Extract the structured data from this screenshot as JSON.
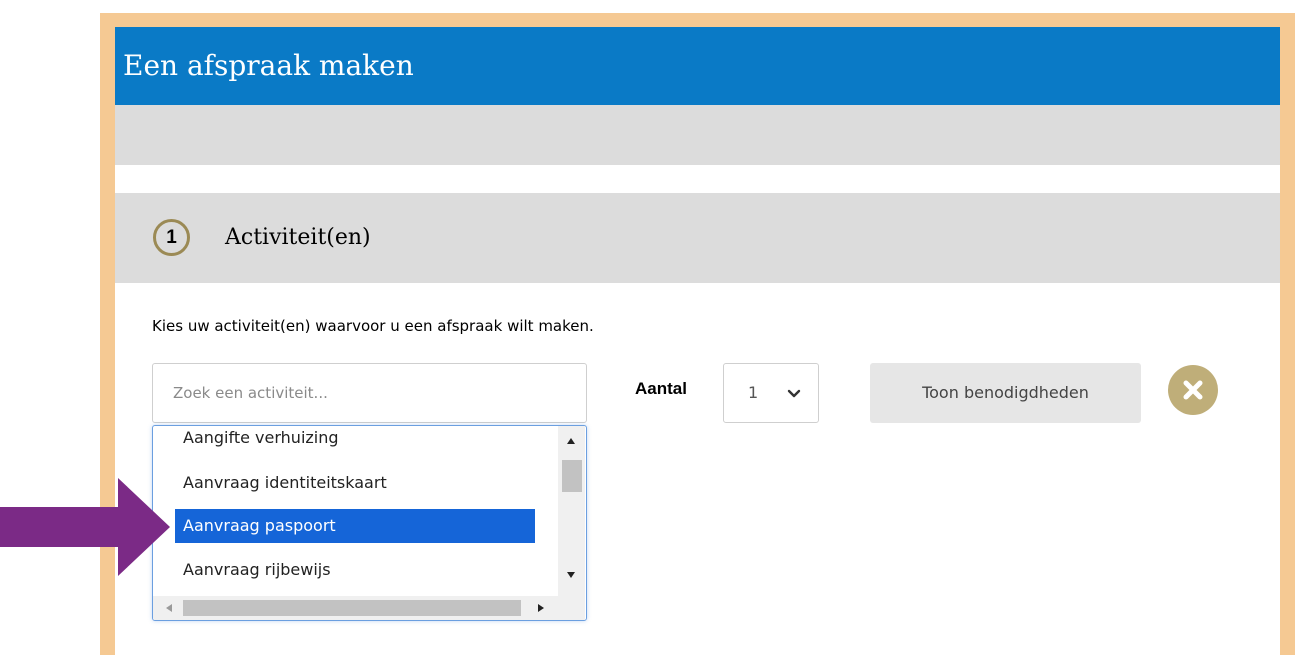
{
  "header": {
    "title": "Een afspraak maken"
  },
  "step": {
    "number": "1",
    "title": "Activiteit(en)"
  },
  "instruction": "Kies uw activiteit(en) waarvoor u een afspraak wilt maken.",
  "search": {
    "placeholder": "Zoek een activiteit...",
    "value": ""
  },
  "aantal": {
    "label": "Aantal",
    "value": "1"
  },
  "buttons": {
    "toon": "Toon benodigdheden",
    "close_icon": "close-icon"
  },
  "activities": {
    "items": [
      "Aangifte verhuizing",
      "Aanvraag identiteitskaart",
      "Aanvraag paspoort",
      "Aanvraag rijbewijs"
    ],
    "selected": "Aanvraag paspoort"
  },
  "colors": {
    "header_bg": "#0a7ac6",
    "frame": "#f5c993",
    "accent_gold": "#bfae79",
    "selected_bg": "#1565d8",
    "pointer_arrow": "#7b2a86"
  }
}
